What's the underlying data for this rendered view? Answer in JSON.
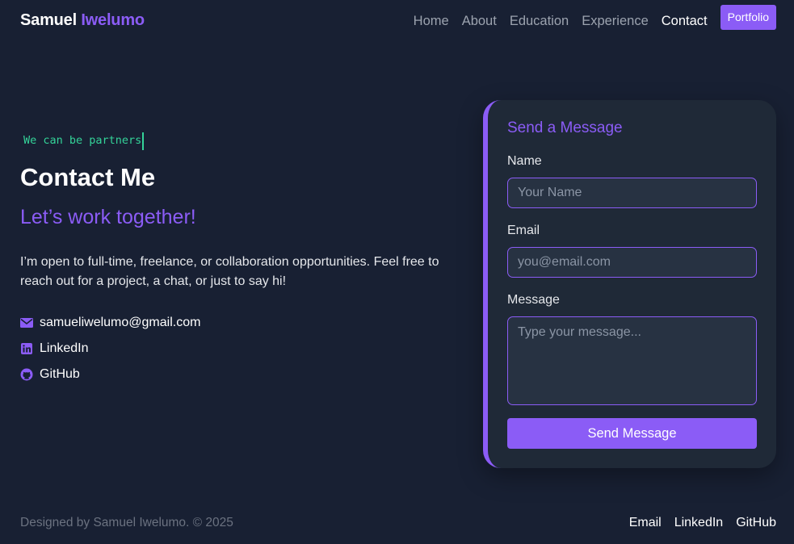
{
  "brand": {
    "first": "Samuel",
    "last": "Iwelumo"
  },
  "nav": {
    "links": [
      "Home",
      "About",
      "Education",
      "Experience",
      "Contact"
    ],
    "active": "Contact",
    "cta": "Portfolio"
  },
  "hero": {
    "tagline": "We can be partners",
    "title": "Contact Me",
    "subtitle": "Let’s work together!",
    "intro": "I’m open to full-time, freelance, or collaboration opportunities. Feel free to reach out for a project, a chat, or just to say hi!"
  },
  "contacts": [
    {
      "icon": "envelope-icon",
      "label": "samueliwelumo@gmail.com"
    },
    {
      "icon": "linkedin-icon",
      "label": "LinkedIn"
    },
    {
      "icon": "github-icon",
      "label": "GitHub"
    }
  ],
  "form": {
    "title": "Send a Message",
    "name_label": "Name",
    "name_placeholder": "Your Name",
    "email_label": "Email",
    "email_placeholder": "you@email.com",
    "message_label": "Message",
    "message_placeholder": "Type your message...",
    "submit": "Send Message"
  },
  "footer": {
    "note": "Designed by Samuel Iwelumo. © 2025",
    "links": [
      "Email",
      "LinkedIn",
      "GitHub"
    ]
  },
  "colors": {
    "background": "#182033",
    "accent": "#8b5cf6",
    "tagline": "#34d399",
    "card": "#1f2937"
  }
}
